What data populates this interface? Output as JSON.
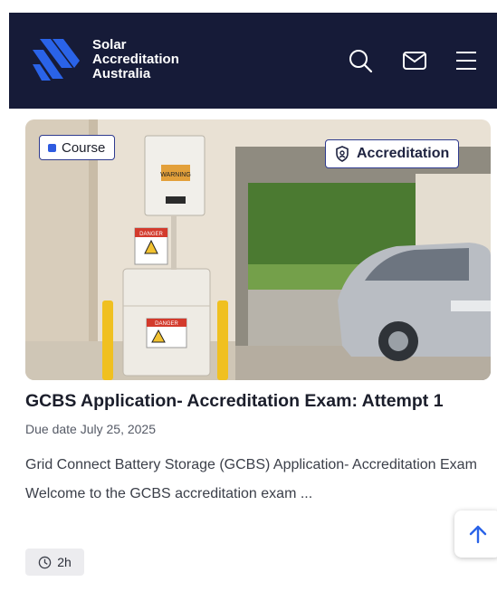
{
  "header": {
    "logo_line1": "Solar",
    "logo_line2": "Accreditation",
    "logo_line3": "Australia",
    "icons": [
      "search-icon",
      "mail-icon",
      "menu-icon"
    ]
  },
  "card": {
    "badge_course": "Course",
    "badge_accreditation": "Accreditation",
    "image_sign_warning": "WARNING",
    "image_sign_danger_1": "DANGER",
    "image_sign_danger_2": "DANGER",
    "title": "GCBS Application- Accreditation Exam: Attempt 1",
    "due_date": "Due date July 25, 2025",
    "description": "Grid Connect Battery Storage (GCBS) Application- Accreditation Exam   Welcome to the GCBS accreditation exam ...",
    "duration": "2h"
  },
  "colors": {
    "header_bg": "#161b38",
    "logo_blue": "#2a63e8",
    "badge_border": "#2f3b8f",
    "scroll_arrow": "#2a63e8"
  }
}
